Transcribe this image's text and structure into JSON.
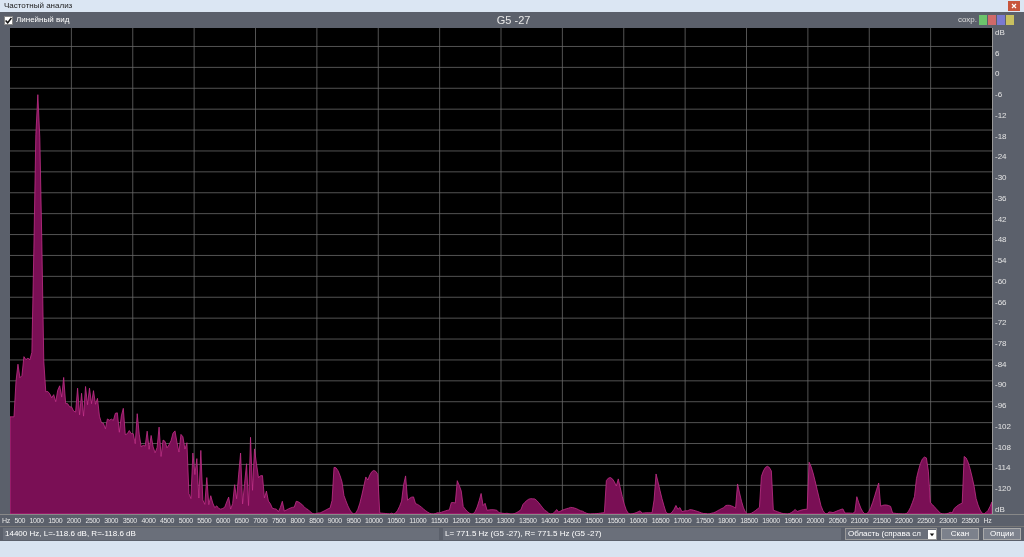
{
  "window": {
    "title": "Частотный анализ"
  },
  "toolbar": {
    "linear_view": {
      "label": "Линейный вид",
      "checked": true
    },
    "note": "G5 -27",
    "save_label": "сохр.",
    "swatches": [
      {
        "color": "#6cc46c"
      },
      {
        "color": "#d06a6a"
      },
      {
        "color": "#7a7ad0"
      },
      {
        "color": "#c8c060"
      }
    ]
  },
  "y_axis": {
    "labels": [
      "dB",
      "6",
      "0",
      "-6",
      "-12",
      "-18",
      "-24",
      "-30",
      "-36",
      "-42",
      "-48",
      "-54",
      "-60",
      "-66",
      "-72",
      "-78",
      "-84",
      "-90",
      "-96",
      "-102",
      "-108",
      "-114",
      "-120",
      "dB"
    ]
  },
  "x_axis": {
    "labels": [
      "Hz",
      "500",
      "1000",
      "1500",
      "2000",
      "2500",
      "3000",
      "3500",
      "4000",
      "4500",
      "5000",
      "5500",
      "6000",
      "6500",
      "7000",
      "7500",
      "8000",
      "8500",
      "9000",
      "9500",
      "10000",
      "10500",
      "11000",
      "11500",
      "12000",
      "12500",
      "13000",
      "13500",
      "14000",
      "14500",
      "15000",
      "15500",
      "16000",
      "16500",
      "17000",
      "17500",
      "18000",
      "18500",
      "19000",
      "19500",
      "20000",
      "20500",
      "21000",
      "21500",
      "22000",
      "22500",
      "23000",
      "23500",
      "Hz"
    ]
  },
  "status_bar": {
    "cursor": "14400 Hz, L=-118.6 dB, R=-118.6 dB",
    "peak": "L= 771.5 Hz (G5 -27), R= 771.5 Hz (G5 -27)",
    "mode": "Область (справа сл",
    "buttons": [
      "Скан",
      "Опции"
    ]
  }
}
